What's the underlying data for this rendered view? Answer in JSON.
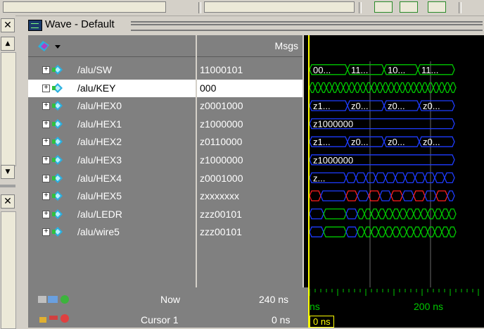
{
  "window": {
    "title": "Wave - Default"
  },
  "header": {
    "msgs_label": "Msgs"
  },
  "sidebar": {
    "close_glyph": "✕",
    "up_glyph": "▲",
    "down_glyph": "▼"
  },
  "signals": [
    {
      "name": "/alu/SW",
      "value": "11000101"
    },
    {
      "name": "/alu/KEY",
      "value": "000"
    },
    {
      "name": "/alu/HEX0",
      "value": "z0001000"
    },
    {
      "name": "/alu/HEX1",
      "value": "z1000000"
    },
    {
      "name": "/alu/HEX2",
      "value": "z0110000"
    },
    {
      "name": "/alu/HEX3",
      "value": "z1000000"
    },
    {
      "name": "/alu/HEX4",
      "value": "z0001000"
    },
    {
      "name": "/alu/HEX5",
      "value": "zxxxxxxx"
    },
    {
      "name": "/alu/LEDR",
      "value": "zzz00101"
    },
    {
      "name": "/alu/wire5",
      "value": "zzz00101"
    }
  ],
  "wave_labels": {
    "sw": [
      "00...",
      "11...",
      "10...",
      "11..."
    ],
    "hex0": [
      "z1...",
      "z0...",
      "z0...",
      "z0..."
    ],
    "hex1": [
      "z1000000"
    ],
    "hex2": [
      "z1...",
      "z0...",
      "z0...",
      "z0..."
    ],
    "hex3": [
      "z1000000"
    ],
    "hex4": [
      "z..."
    ]
  },
  "status": {
    "now_label": "Now",
    "now_value": "240 ns",
    "cursor_label": "Cursor 1",
    "cursor_value": "0 ns",
    "ruler_left": "ns",
    "ruler_mark": "200 ns",
    "cursor_time": "0 ns"
  },
  "colors": {
    "bus": "#00c800",
    "signal_blue": "#1e3cff",
    "signal_red": "#ff1e1e",
    "cursor": "#ffff00"
  }
}
